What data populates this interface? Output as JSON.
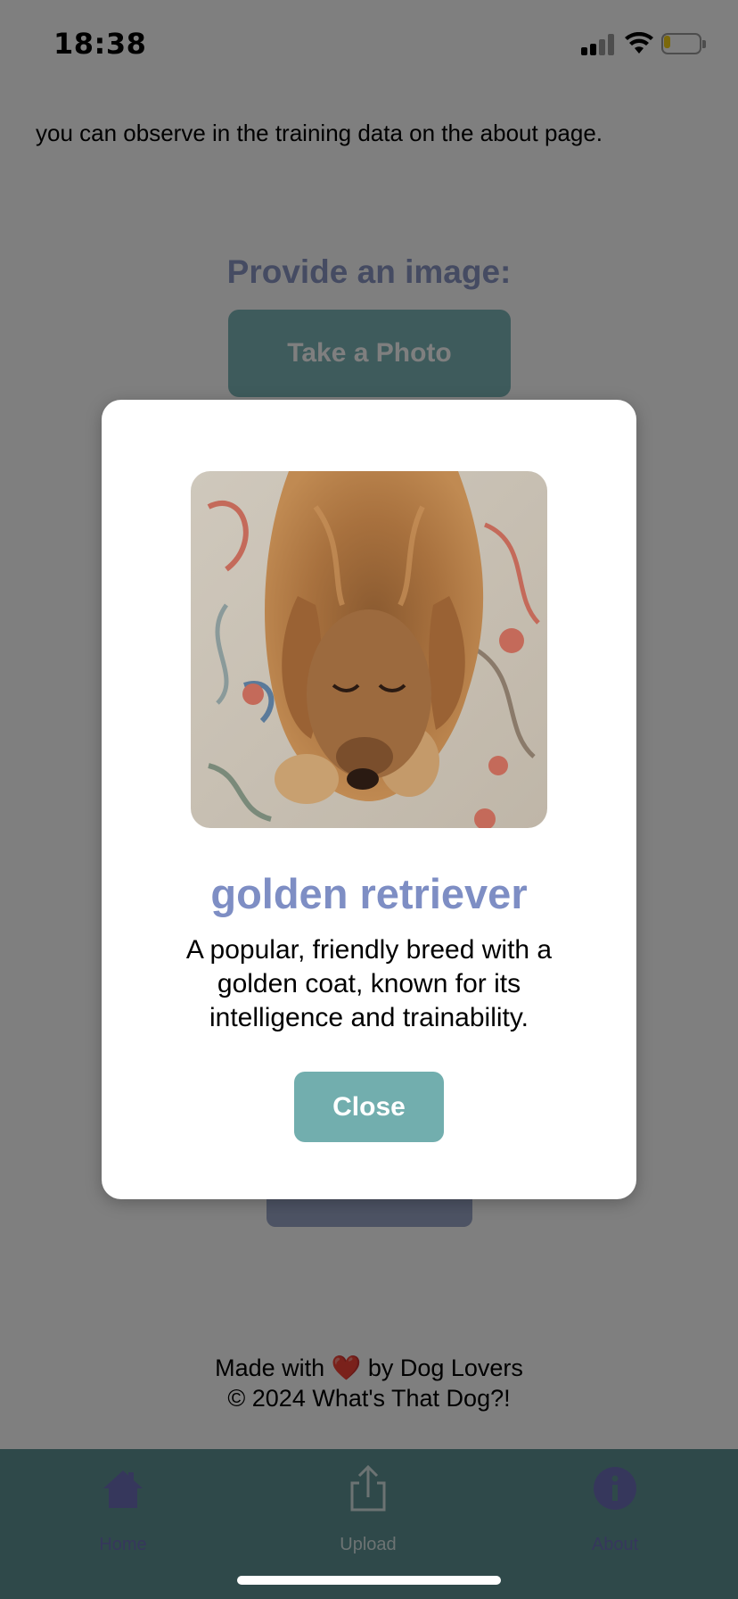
{
  "status_bar": {
    "time": "18:38",
    "icons": [
      "cellular-signal-icon",
      "wifi-icon",
      "battery-icon"
    ],
    "battery_level": 0.18
  },
  "page": {
    "intro_text": "you can observe in the training data on the about page.",
    "provide_heading": "Provide an image:",
    "take_photo_label": "Take a Photo"
  },
  "footer": {
    "made_with_prefix": "Made with",
    "heart": "❤️",
    "made_with_suffix": "by Dog Lovers",
    "copyright": "© 2024 What's That Dog?!"
  },
  "tab_bar": {
    "items": [
      {
        "label": "Home",
        "icon": "home-icon",
        "active": false
      },
      {
        "label": "Upload",
        "icon": "upload-icon",
        "active": true
      },
      {
        "label": "About",
        "icon": "info-icon",
        "active": false
      }
    ]
  },
  "modal": {
    "image_icon": "dog-photo",
    "breed": "golden retriever",
    "description": "A popular, friendly breed with a golden coat, known for its intelligence and trainability.",
    "close_label": "Close"
  },
  "colors": {
    "accent_teal": "#72aeae",
    "breed_title": "#7e8ec4",
    "tab_bar": "#5e9294",
    "overlay": "rgba(0,0,0,0.5)"
  }
}
